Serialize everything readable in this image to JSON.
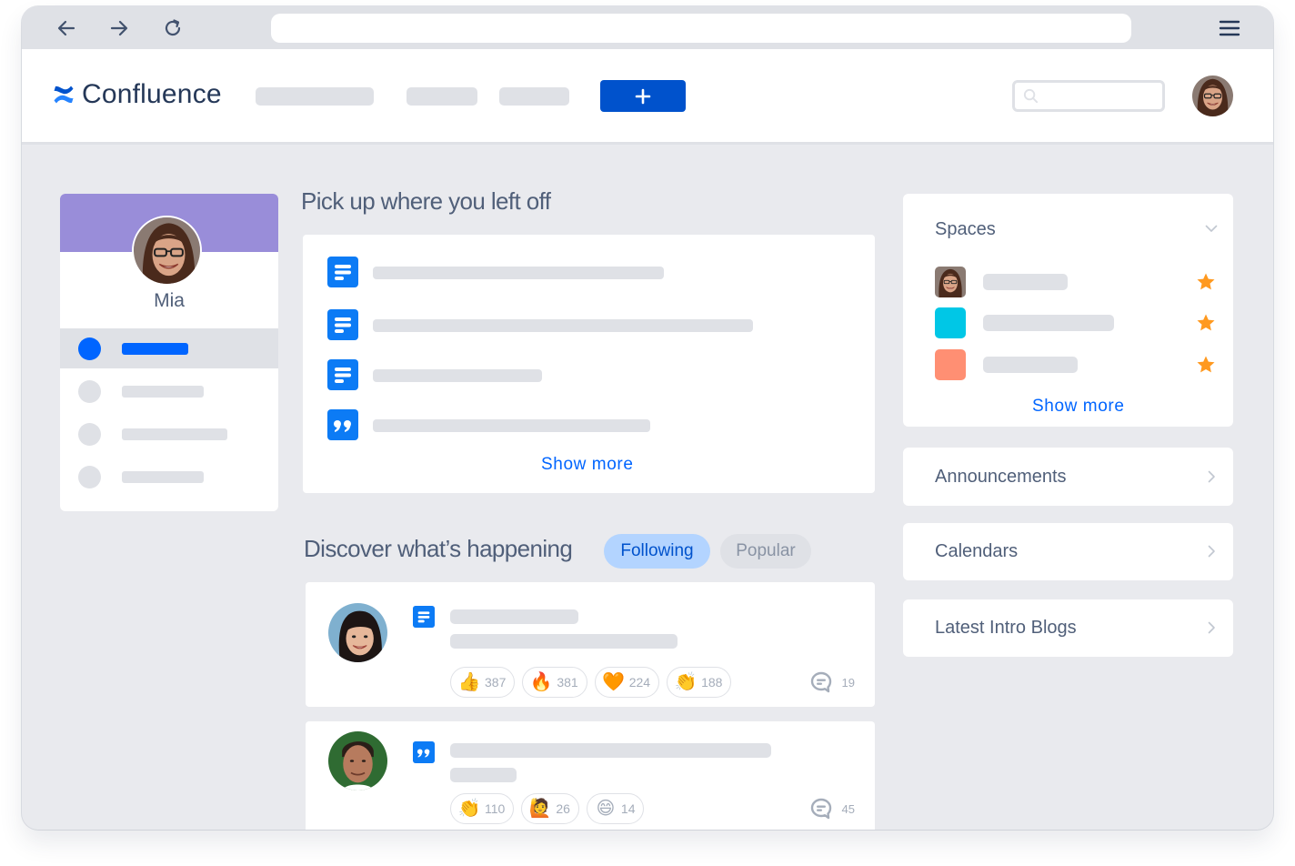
{
  "browser": {
    "back_icon": "arrow-left-icon",
    "forward_icon": "arrow-right-icon",
    "reload_icon": "reload-icon",
    "url": "",
    "menu_icon": "hamburger-menu-icon"
  },
  "header": {
    "logo_text": "Confluence",
    "create_label": "+",
    "search_placeholder": "",
    "colors": {
      "primary": "#0052cc",
      "logo": "#2684ff"
    }
  },
  "profile": {
    "name": "Mia",
    "banner_color": "#998dd9",
    "nav_items": [
      {
        "active": true
      },
      {
        "active": false
      },
      {
        "active": false
      },
      {
        "active": false
      }
    ]
  },
  "recent": {
    "title": "Pick up where you left off",
    "items": [
      {
        "type": "page-icon"
      },
      {
        "type": "page-icon"
      },
      {
        "type": "page-icon"
      },
      {
        "type": "blog-quote-icon"
      }
    ],
    "show_more": "Show more"
  },
  "discover": {
    "title": "Discover what’s happening",
    "tabs": [
      {
        "label": "Following",
        "selected": true
      },
      {
        "label": "Popular",
        "selected": false
      }
    ],
    "feed": [
      {
        "type": "page-icon",
        "reactions": [
          {
            "emoji": "👍",
            "name": "thumbs-up",
            "count": "387"
          },
          {
            "emoji": "🔥",
            "name": "fire",
            "count": "381"
          },
          {
            "emoji": "🧡",
            "name": "orange-heart",
            "count": "224"
          },
          {
            "emoji": "👏",
            "name": "clap",
            "count": "188"
          }
        ],
        "comments": "19"
      },
      {
        "type": "blog-quote-icon",
        "reactions": [
          {
            "emoji": "👏",
            "name": "clap",
            "count": "110"
          },
          {
            "emoji": "🙋",
            "name": "raising-hand",
            "count": "26"
          },
          {
            "emoji": "😄",
            "name": "grinning",
            "count": "14"
          }
        ],
        "comments": "45"
      }
    ]
  },
  "sidebar": {
    "spaces": {
      "title": "Spaces",
      "items": [
        {
          "icon": "avatar",
          "starred": true
        },
        {
          "icon": "color",
          "color": "#00c7e6",
          "starred": true
        },
        {
          "icon": "color",
          "color": "#ff8f73",
          "starred": true
        }
      ],
      "show_more": "Show more"
    },
    "links": [
      {
        "label": "Announcements"
      },
      {
        "label": "Calendars"
      },
      {
        "label": "Latest Intro Blogs"
      }
    ],
    "star_color": "#ff991f"
  }
}
